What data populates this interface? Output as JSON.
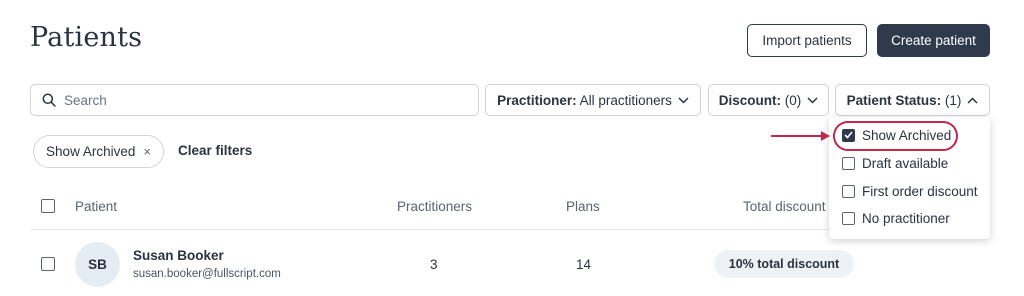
{
  "page": {
    "title": "Patients"
  },
  "actions": {
    "import_label": "Import patients",
    "create_label": "Create patient"
  },
  "search": {
    "placeholder": "Search",
    "value": "",
    "icon": "search-icon"
  },
  "filters": {
    "practitioner": {
      "label": "Practitioner:",
      "value": "All practitioners"
    },
    "discount": {
      "label": "Discount:",
      "value": "(0)"
    },
    "status": {
      "label": "Patient Status:",
      "value": "(1)"
    }
  },
  "active_filters": {
    "chip_label": "Show Archived",
    "chip_remove": "×",
    "clear_label": "Clear filters"
  },
  "status_menu": {
    "items": [
      {
        "label": "Show Archived",
        "checked": true
      },
      {
        "label": "Draft available",
        "checked": false
      },
      {
        "label": "First order discount",
        "checked": false
      },
      {
        "label": "No practitioner",
        "checked": false
      }
    ]
  },
  "table": {
    "headers": {
      "patient": "Patient",
      "practitioners": "Practitioners",
      "plans": "Plans",
      "discount": "Total discount"
    },
    "rows": [
      {
        "initials": "SB",
        "name": "Susan Booker",
        "email": "susan.booker@fullscript.com",
        "practitioners": "3",
        "plans": "14",
        "discount": "10% total discount"
      }
    ]
  },
  "colors": {
    "primary": "#2f3b4c",
    "annotation": "#c3274a"
  }
}
